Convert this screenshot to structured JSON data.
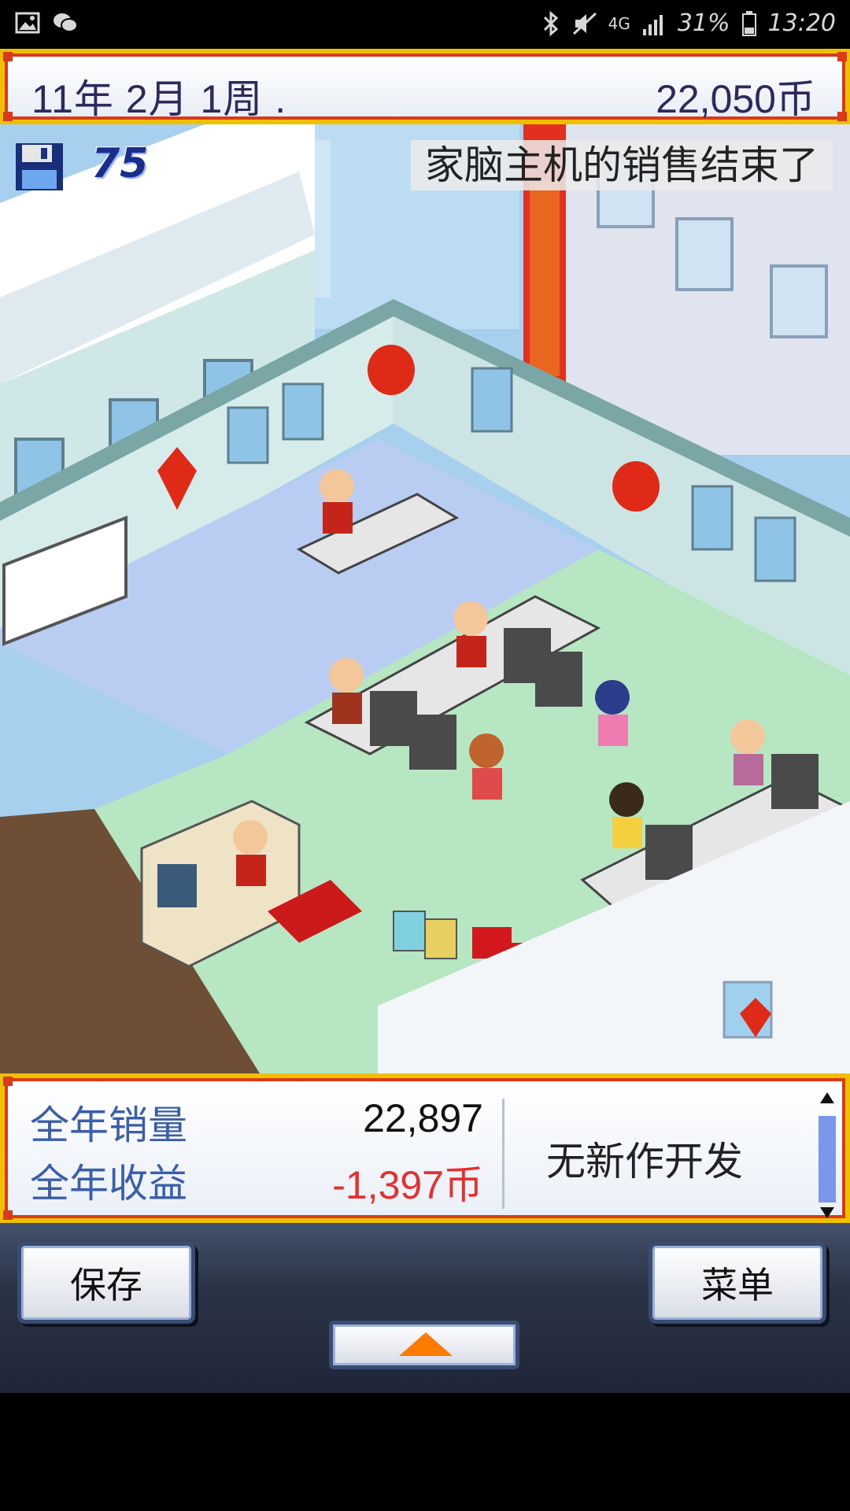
{
  "status_bar": {
    "network": "4G",
    "battery": "31%",
    "time": "13:20"
  },
  "top_bar": {
    "date": "11年 2月 1周 .",
    "money": "22,050币"
  },
  "scene": {
    "save_count": "75",
    "notice": "家脑主机的销售结束了"
  },
  "stats": {
    "annual_sales_label": "全年销量",
    "annual_sales_value": "22,897",
    "annual_profit_label": "全年收益",
    "annual_profit_value": "-1,397币",
    "development_status": "无新作开发"
  },
  "controls": {
    "save_label": "保存",
    "menu_label": "菜单"
  },
  "colors": {
    "frame_gold": "#f0c000",
    "frame_red": "#d93a1a",
    "text_navy": "#2c2a5c",
    "label_blue": "#3a5ea8",
    "negative_red": "#e53030",
    "arrow_orange": "#ff7a00"
  }
}
